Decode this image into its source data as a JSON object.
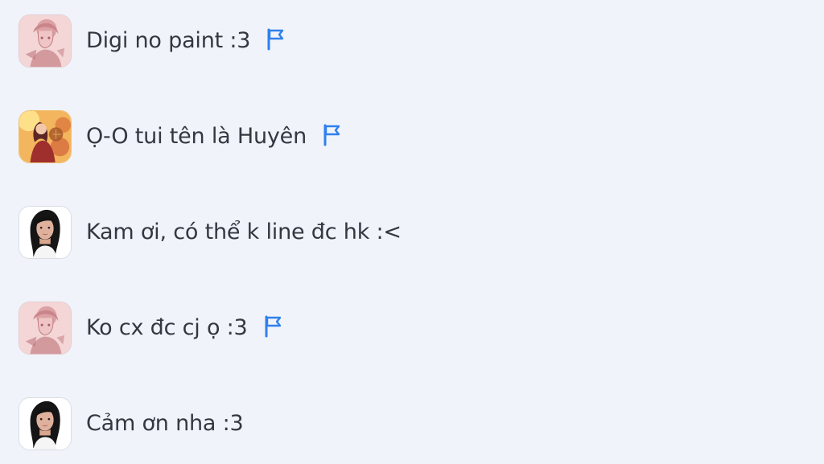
{
  "messages": [
    {
      "text": "Digi no paint :3",
      "avatar_icon": "anime-girl-pink-avatar-icon",
      "has_flag": true
    },
    {
      "text": "Ọ-O tui tên là Huyên",
      "avatar_icon": "autumn-girl-avatar-icon",
      "has_flag": true
    },
    {
      "text": "Kam ơi, có thể k line đc hk :<",
      "avatar_icon": "portrait-girl-avatar-icon",
      "has_flag": false
    },
    {
      "text": "Ko cx đc cj ọ :3",
      "avatar_icon": "anime-girl-pink-avatar-icon",
      "has_flag": true
    },
    {
      "text": "Cảm ơn nha :3",
      "avatar_icon": "portrait-girl-avatar-icon",
      "has_flag": false
    }
  ],
  "colors": {
    "background": "#f0f3f9",
    "text": "#333840",
    "flag": "#2f80ed"
  },
  "flag_icon": "flag-icon"
}
